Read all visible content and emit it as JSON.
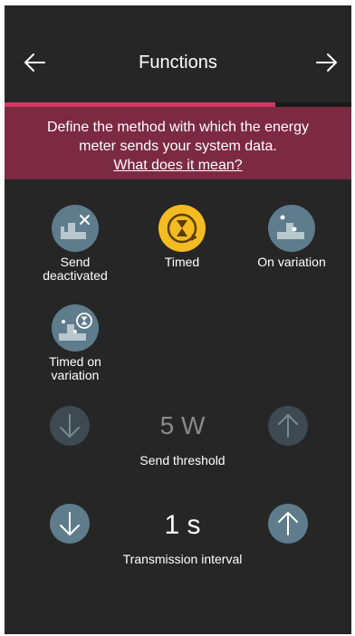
{
  "header": {
    "title": "Functions",
    "back_icon": "arrow-left-icon",
    "forward_icon": "arrow-right-icon"
  },
  "progress": {
    "fraction": 0.78,
    "color": "#d63564"
  },
  "banner": {
    "line1": "Define the method with which the energy",
    "line2": "meter sends your system data.",
    "link": "What does it mean?",
    "background": "#7c2a42"
  },
  "modes": [
    {
      "label_line1": "Send",
      "label_line2": "deactivated",
      "icon": "send-deactivated-icon",
      "selected": false
    },
    {
      "label_line1": "Timed",
      "label_line2": "",
      "icon": "hourglass-icon",
      "selected": true
    },
    {
      "label_line1": "On variation",
      "label_line2": "",
      "icon": "variation-icon",
      "selected": false
    },
    {
      "label_line1": "Timed on",
      "label_line2": "variation",
      "icon": "timed-variation-icon",
      "selected": false
    }
  ],
  "threshold": {
    "value": "5 W",
    "label": "Send threshold",
    "enabled": false
  },
  "interval": {
    "value": "1 s",
    "label": "Transmission interval",
    "enabled": true
  },
  "colors": {
    "accent_yellow": "#f5bb22",
    "button_blue": "#5e7c8c",
    "background": "#262626"
  }
}
